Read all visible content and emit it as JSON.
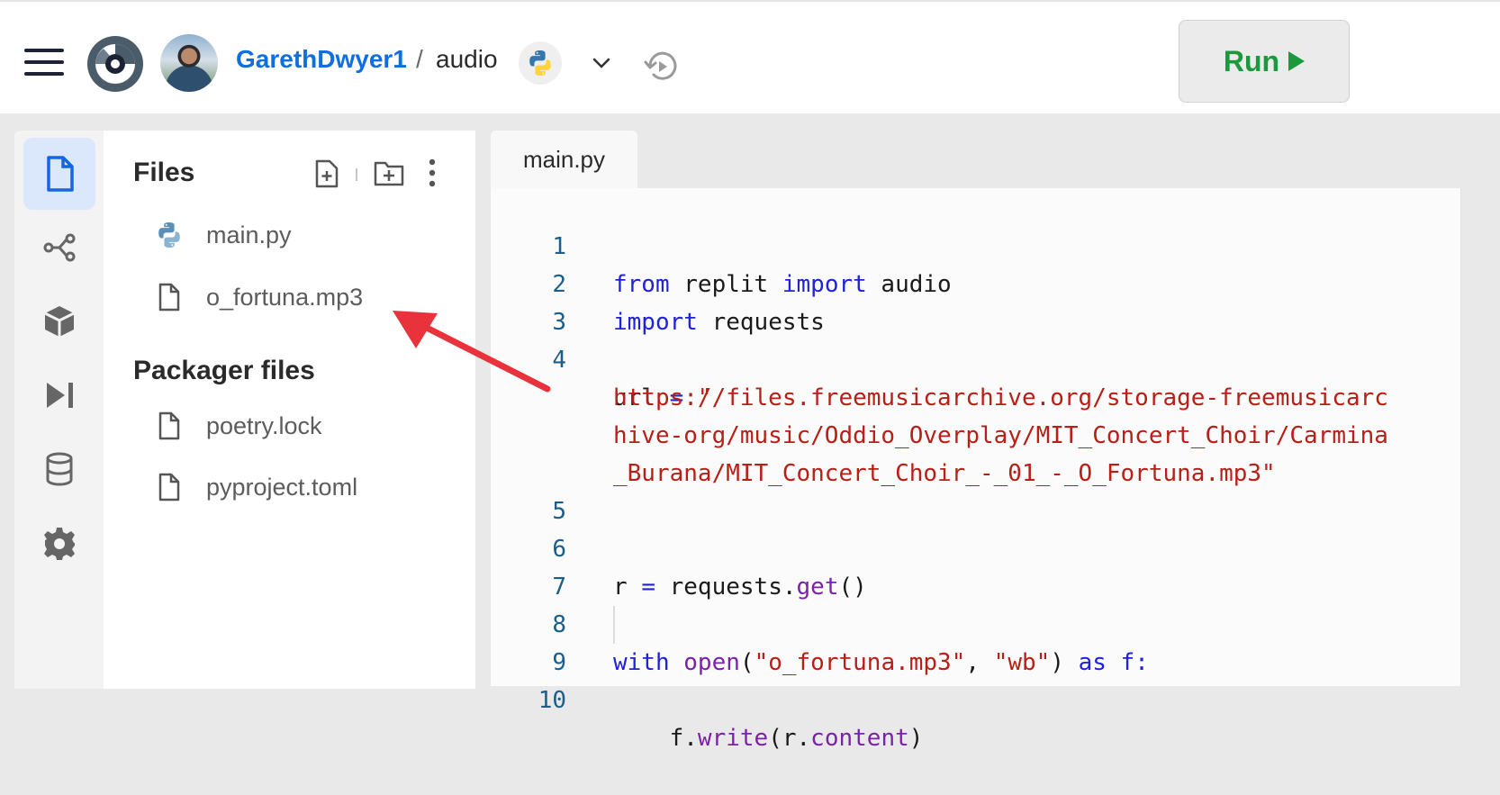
{
  "header": {
    "username": "GarethDwyer1",
    "separator": "/",
    "repl_name": "audio",
    "run_label": "Run"
  },
  "sidebar": {
    "files_title": "Files",
    "files": [
      {
        "name": "main.py",
        "icon": "python-icon"
      },
      {
        "name": "o_fortuna.mp3",
        "icon": "file-icon"
      }
    ],
    "packager_title": "Packager files",
    "packager_files": [
      {
        "name": "poetry.lock",
        "icon": "file-icon"
      },
      {
        "name": "pyproject.toml",
        "icon": "file-icon"
      }
    ]
  },
  "activity_bar": [
    "files-icon",
    "version-control-icon",
    "packages-icon",
    "debugger-icon",
    "database-icon",
    "settings-icon"
  ],
  "editor": {
    "tab_label": "main.py",
    "line_numbers": [
      "1",
      "2",
      "3",
      "4",
      "5",
      "6",
      "7",
      "8",
      "9",
      "10"
    ],
    "code": {
      "l1": [
        "from",
        " replit ",
        "import",
        " audio"
      ],
      "l2": [
        "import",
        " requests"
      ],
      "l4": [
        "url ",
        "=",
        " \""
      ],
      "l4_cont1": "https://files.freemusicarchive.org/storage-freemusicarc",
      "l4_cont2": "hive-org/music/Oddio_Overplay/MIT_Concert_Choir/Carmina",
      "l4_cont3": "_Burana/MIT_Concert_Choir_-_01_-_O_Fortuna.mp3\"",
      "l6": [
        "r ",
        "=",
        " requests.",
        "get",
        "()"
      ],
      "l8": [
        "with",
        " ",
        "open",
        "(",
        "\"o_fortuna.mp3\"",
        ", ",
        "\"wb\"",
        ") ",
        "as",
        " f:"
      ],
      "l9": [
        "    f.",
        "write",
        "(r.",
        "content",
        ")"
      ]
    }
  },
  "colors": {
    "accent": "#0f6fe0",
    "run_green": "#1a9a3c",
    "annotation_arrow": "#e8323c"
  }
}
